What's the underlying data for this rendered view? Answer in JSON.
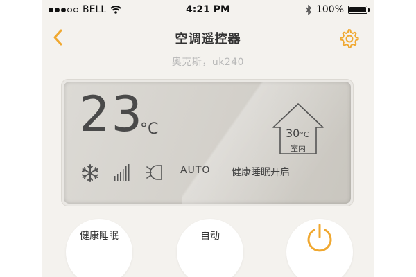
{
  "status_bar": {
    "carrier": "BELL",
    "time": "4:21 PM",
    "battery_text": "100%",
    "battery_level": 1.0,
    "signal_dots_filled": 3,
    "signal_dots_total": 5
  },
  "header": {
    "title": "空调遥控器",
    "subtitle": "奥克斯，uk240",
    "back_icon": "chevron-left-icon",
    "settings_icon": "gear-icon"
  },
  "display": {
    "set_temp": "23",
    "set_temp_unit": "°C",
    "indoor_temp": "30",
    "indoor_unit": "°C",
    "indoor_label": "室内",
    "mode_text": "AUTO",
    "sleep_status": "健康睡眠开启",
    "icons": [
      "snowflake-icon",
      "fan-speed-icon",
      "swing-icon"
    ]
  },
  "buttons": {
    "sleep_label": "健康睡眠",
    "auto_label": "自动",
    "power_icon": "power-icon"
  },
  "colors": {
    "accent": "#f0a830",
    "background": "#f4f2ee",
    "panel": "#d5d2cc",
    "text": "#444444"
  }
}
